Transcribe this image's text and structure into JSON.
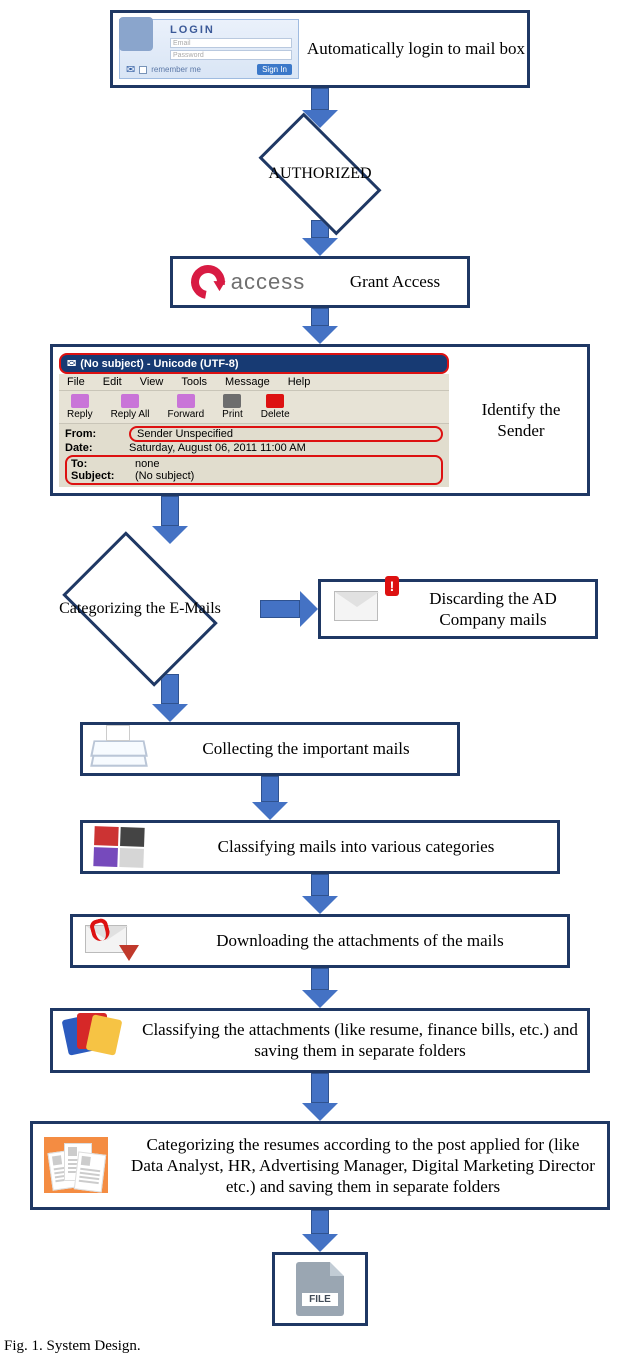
{
  "step1": {
    "label": "Automatically login to mail box",
    "login": {
      "title": "LOGIN",
      "field1": "Email",
      "field2": "Password",
      "remember": "remember me",
      "signin": "Sign In"
    }
  },
  "diamond1": "AUTHORIZED",
  "step2": {
    "label": "Grant Access",
    "logo_text": "access"
  },
  "mail": {
    "title": "(No subject) - Unicode (UTF-8)",
    "menu": {
      "file": "File",
      "edit": "Edit",
      "view": "View",
      "tools": "Tools",
      "message": "Message",
      "help": "Help"
    },
    "tool": {
      "reply": "Reply",
      "replyall": "Reply All",
      "forward": "Forward",
      "print": "Print",
      "delete": "Delete"
    },
    "headers": {
      "from_lbl": "From:",
      "from": "Sender Unspecified",
      "date_lbl": "Date:",
      "date": "Saturday, August 06, 2011 11:00 AM",
      "to_lbl": "To:",
      "to": "none",
      "subj_lbl": "Subject:",
      "subj": "(No subject)"
    },
    "side_label": "Identify the Sender"
  },
  "diamond2": "Categorizing the E-Mails",
  "discard": "Discarding the AD Company mails",
  "collect": "Collecting the important mails",
  "classify_mails": "Classifying mails into various categories",
  "download": "Downloading the attachments of the mails",
  "classify_attach": "Classifying the attachments (like resume, finance bills, etc.) and saving them in separate folders",
  "categorize_resumes": "Categorizing the resumes according to the post applied for (like Data Analyst, HR, Advertising Manager, Digital Marketing Director etc.) and saving them in separate folders",
  "file_label": "FILE",
  "caption": "Fig. 1.   System Design."
}
